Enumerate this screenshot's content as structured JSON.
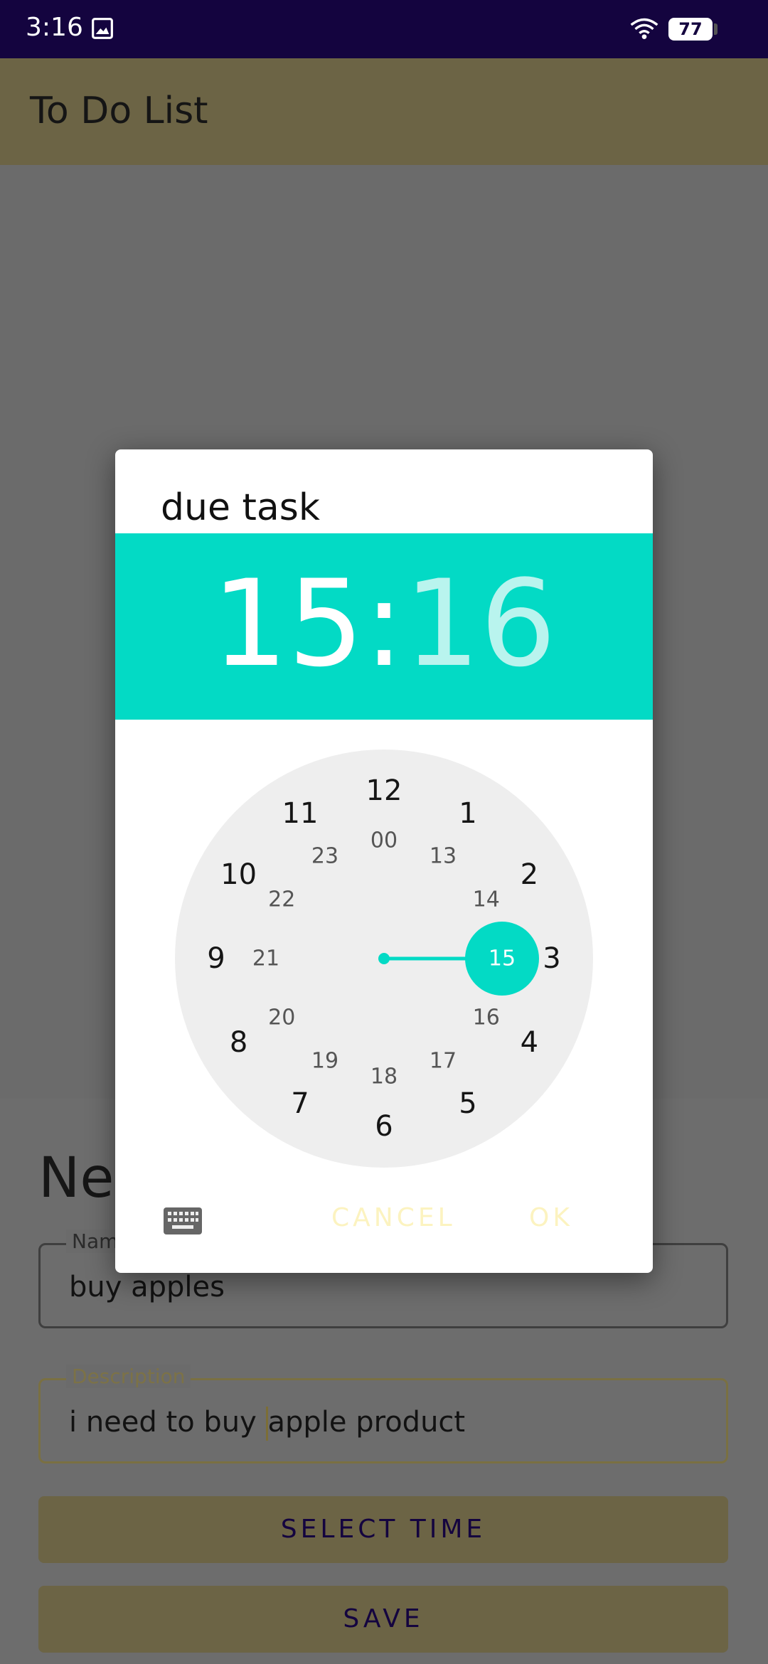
{
  "status_bar": {
    "time": "3:16",
    "battery": "77",
    "icons": [
      "image-icon",
      "wifi-icon",
      "battery-icon"
    ]
  },
  "app_bar": {
    "title": "To Do List"
  },
  "form": {
    "heading": "Nev",
    "name_label": "Name",
    "name_value": "buy apples",
    "description_label": "Description",
    "description_before_caret": "i need to buy ",
    "description_after_caret": "apple product",
    "select_time_label": "SELECT TIME",
    "save_label": "SAVE"
  },
  "dialog": {
    "title": "due task",
    "hour": "15",
    "separator": ":",
    "minute": "16",
    "outer_numbers": [
      "12",
      "1",
      "2",
      "3",
      "4",
      "5",
      "6",
      "7",
      "8",
      "9",
      "10",
      "11"
    ],
    "inner_numbers": [
      "00",
      "13",
      "14",
      "15",
      "16",
      "17",
      "18",
      "19",
      "20",
      "21",
      "22",
      "23"
    ],
    "selected": "15",
    "cancel_label": "CANCEL",
    "ok_label": "OK",
    "accent_color": "#03dac5"
  }
}
